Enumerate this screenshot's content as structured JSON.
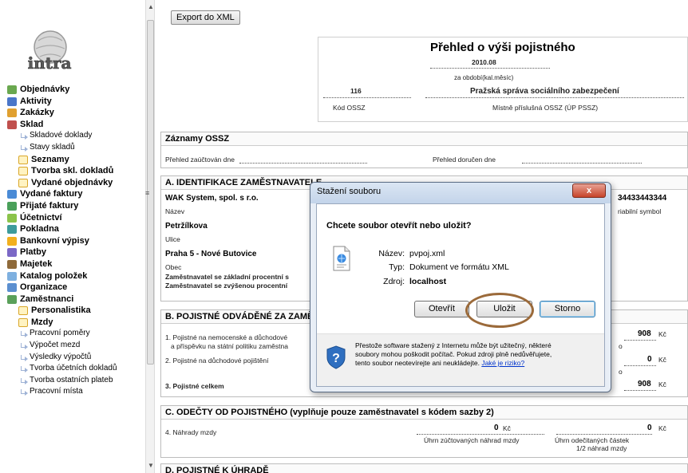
{
  "sidebar": {
    "logo_text": "intra",
    "items": [
      {
        "label": "Objednávky",
        "level": 0,
        "color": "#6aa84f"
      },
      {
        "label": "Aktivity",
        "level": 0,
        "color": "#4a76c9"
      },
      {
        "label": "Zakázky",
        "level": 0,
        "color": "#e0a030"
      },
      {
        "label": "Sklad",
        "level": 0,
        "color": "#c0504d"
      },
      {
        "label": "Skladové doklady",
        "level": 2
      },
      {
        "label": "Stavy skladů",
        "level": 2
      },
      {
        "label": "Seznamy",
        "level": 1
      },
      {
        "label": "Tvorba skl. dokladů",
        "level": 1
      },
      {
        "label": "Vydané objednávky",
        "level": 1
      },
      {
        "label": "Vydané faktury",
        "level": 0,
        "color": "#4a8bd6"
      },
      {
        "label": "Přijaté faktury",
        "level": 0,
        "color": "#4aa05a"
      },
      {
        "label": "Účetnictví",
        "level": 0,
        "color": "#8bc34a"
      },
      {
        "label": "Pokladna",
        "level": 0,
        "color": "#3d9b9b"
      },
      {
        "label": "Bankovní výpisy",
        "level": 0,
        "color": "#f2b01e"
      },
      {
        "label": "Platby",
        "level": 0,
        "color": "#7b68c6"
      },
      {
        "label": "Majetek",
        "level": 0,
        "color": "#8f6a3a"
      },
      {
        "label": "Katalog položek",
        "level": 0,
        "color": "#7eb0e0"
      },
      {
        "label": "Organizace",
        "level": 0,
        "color": "#5b8fd0"
      },
      {
        "label": "Zaměstnanci",
        "level": 0,
        "color": "#5aa05a"
      },
      {
        "label": "Personalistika",
        "level": 1
      },
      {
        "label": "Mzdy",
        "level": 1
      },
      {
        "label": "Pracovní poměry",
        "level": 2
      },
      {
        "label": "Výpočet mezd",
        "level": 2
      },
      {
        "label": "Výsledky výpočtů",
        "level": 2
      },
      {
        "label": "Tvorba účetních dokladů",
        "level": 2
      },
      {
        "label": "Tvorba ostatních plateb",
        "level": 2
      },
      {
        "label": "Pracovní místa",
        "level": 2
      }
    ]
  },
  "toolbar": {
    "export_label": "Export do XML"
  },
  "report": {
    "title": "Přehled o výši pojistného",
    "period": "2010.08",
    "period_caption": "za období(kal.měsíc)",
    "ossz_code": "116",
    "ossz_name": "Pražská správa sociálního zabezpečení",
    "ossz_code_caption": "Kód OSSZ",
    "ossz_name_caption": "Místně příslušná OSSZ (ÚP PSSZ)"
  },
  "zaznamy": {
    "heading": "Záznamy OSSZ",
    "zauctovan": "Přehled zaúčtován dne",
    "dorucen": "Přehled doručen dne"
  },
  "sectionA": {
    "heading": "A. IDENTIFIKACE ZAMĚSTNAVATELE",
    "company": "WAK System, spol. s r.o.",
    "company_caption": "Název",
    "vs": "34433443344",
    "vs_caption": "riabilní symbol",
    "street": "Petržílkova",
    "street_caption": "Ulice",
    "city": "Praha 5 - Nové Butovice",
    "city_caption": "Obec",
    "rate1": "Zaměstnavatel se základní procentní s",
    "rate2": "Zaměstnavatel se zvýšenou procentní"
  },
  "sectionB": {
    "heading": "B. POJISTNÉ ODVÁDĚNÉ ZA ZAMĚ",
    "row1a": "1. Pojistné na nemocenské a důchodové",
    "row1b": "a příspěvku na státní politiku zaměstna",
    "row2": "2. Pojistné na důchodové pojištění",
    "row3": "3. Pojistné celkem",
    "v1": "908",
    "v2": "0",
    "v3": "908",
    "cur": "Kč",
    "side": "o"
  },
  "sectionC": {
    "heading": "C. ODEČTY OD POJISTNÉHO (vyplňuje pouze zaměstnavatel s kódem sazby 2)",
    "row": "4. Náhrady mzdy",
    "v1": "0",
    "v2": "0",
    "cur": "Kč",
    "cap1": "Úhrn zúčtovaných náhrad mzdy",
    "cap2a": "Úhrn odečitaných částek",
    "cap2b": "1/2 náhrad mzdy"
  },
  "sectionD": {
    "heading": "D. POJISTNÉ K ÚHRADĚ"
  },
  "dialog": {
    "title": "Stažení souboru",
    "close": "x",
    "question": "Chcete soubor otevřít nebo uložit?",
    "name_label": "Název:",
    "name_value": "pvpoj.xml",
    "type_label": "Typ:",
    "type_value": "Dokument ve formátu XML",
    "source_label": "Zdroj:",
    "source_value": "localhost",
    "open": "Otevřít",
    "save": "Uložit",
    "cancel": "Storno",
    "warn1": "Přestože software stažený z Internetu může být užitečný, některé",
    "warn2": "soubory mohou poškodit počítač. Pokud zdroji plně nedůvěřujete,",
    "warn3": "tento soubor neotevírejte ani neukládejte.",
    "warn_link": "Jaké je riziko?"
  }
}
